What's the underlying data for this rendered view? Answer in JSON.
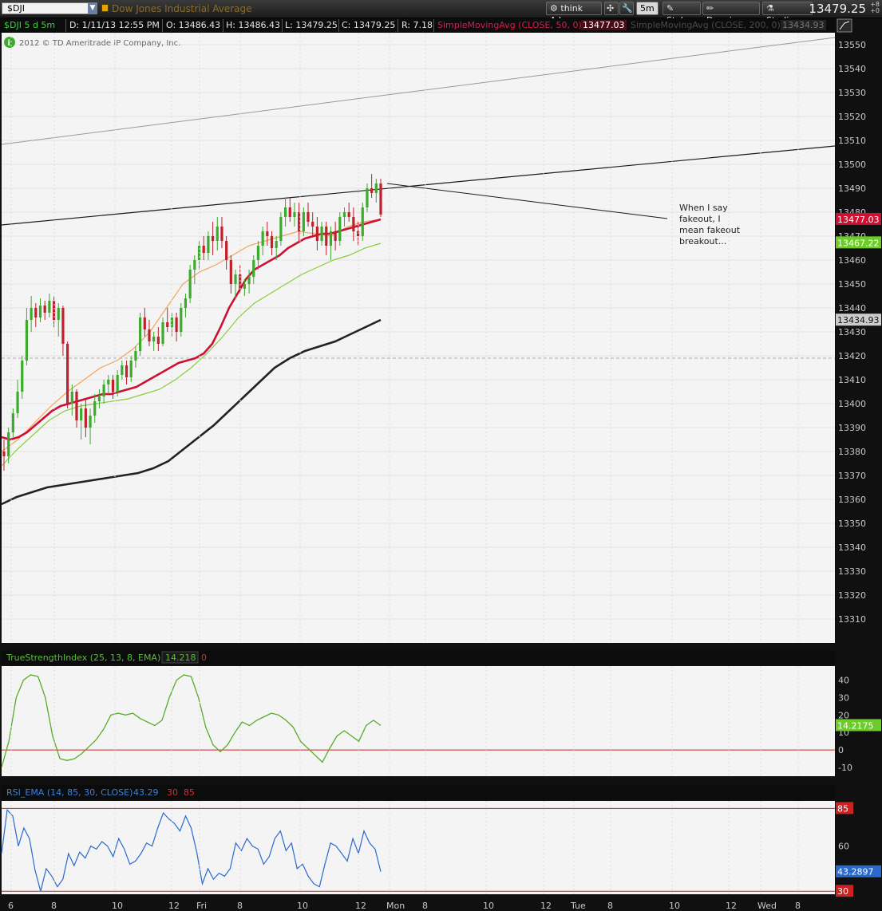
{
  "toolbar": {
    "symbol": "$DJI",
    "symbol_name": "Dow Jones Industrial Average",
    "think_ai": "think A.I.",
    "timeframe": "5m",
    "style": "Style",
    "drawings": "Drawings",
    "studies": "Studies",
    "last_price": "13479.25",
    "price_change_top": "+8",
    "price_change_bottom": "+0"
  },
  "status_bar": {
    "ticker": "$DJI 5 d 5m",
    "date": "D: 1/11/13 12:55 PM",
    "open": "O: 13486.43",
    "high": "H: 13486.43",
    "low": "L: 13479.25",
    "close": "C: 13479.25",
    "range": "R: 7.18",
    "sma50_label": "SimpleMovingAvg (CLOSE, 50, 0)",
    "sma50_value": "13477.03",
    "sma200_label": "SimpleMovingAvg (CLOSE, 200, 0)",
    "sma200_value": "13434.93",
    "copyright": "2012 © TD Ameritrade IP Company, Inc."
  },
  "annotation": {
    "line1": "When I say",
    "line2": "fakeout, I",
    "line3": "mean fakeout",
    "line4": "breakout..."
  },
  "colors": {
    "background": "#000000",
    "panel": "#f4f4f4",
    "up_candle": "#3caa2c",
    "down_candle": "#c0202c",
    "sma50": "#cc1133",
    "sma200": "#222222",
    "green_ma": "#8ccc3c",
    "orange_ma": "#f3a45a",
    "tsi_line": "#5aaa2a",
    "rsi_line": "#2a6acc",
    "ref_line": "#cc2222",
    "price_tag_red": "#cc1133",
    "price_tag_green": "#6ccc28",
    "price_tag_gray": "#cccccc"
  },
  "chart_data": [
    {
      "type": "candlestick",
      "ylim": [
        13300,
        13555
      ],
      "y_ticks": [
        13310,
        13320,
        13330,
        13340,
        13350,
        13360,
        13370,
        13380,
        13390,
        13400,
        13410,
        13420,
        13430,
        13440,
        13450,
        13460,
        13470,
        13480,
        13490,
        13500,
        13510,
        13520,
        13530,
        13540,
        13550
      ],
      "x_tick_labels": [
        "6",
        "8",
        "10",
        "12",
        "Fri",
        "8",
        "10",
        "12",
        "Mon",
        "8",
        "10",
        "12",
        "Tue",
        "8",
        "10",
        "12",
        "Wed",
        "8"
      ],
      "price_tags": [
        {
          "label": "13477.03",
          "value": 13477.03,
          "color": "#cc1133"
        },
        {
          "label": "13467.22",
          "value": 13467.22,
          "color": "#6ccc28"
        },
        {
          "label": "13434.93",
          "value": 13434.93,
          "color": "#cccccc"
        }
      ],
      "reference_level": 13419,
      "candles": [
        [
          13380,
          13385,
          13372,
          13378
        ],
        [
          13378,
          13390,
          13375,
          13388
        ],
        [
          13388,
          13398,
          13386,
          13396
        ],
        [
          13396,
          13410,
          13394,
          13405
        ],
        [
          13405,
          13420,
          13402,
          13418
        ],
        [
          13418,
          13440,
          13416,
          13435
        ],
        [
          13435,
          13445,
          13430,
          13440
        ],
        [
          13440,
          13442,
          13432,
          13436
        ],
        [
          13436,
          13444,
          13434,
          13441
        ],
        [
          13441,
          13443,
          13435,
          13438
        ],
        [
          13438,
          13446,
          13436,
          13443
        ],
        [
          13443,
          13445,
          13432,
          13435
        ],
        [
          13435,
          13442,
          13428,
          13440
        ],
        [
          13440,
          13441,
          13420,
          13425
        ],
        [
          13425,
          13426,
          13398,
          13400
        ],
        [
          13400,
          13408,
          13395,
          13405
        ],
        [
          13405,
          13406,
          13390,
          13393
        ],
        [
          13393,
          13400,
          13385,
          13398
        ],
        [
          13398,
          13402,
          13386,
          13390
        ],
        [
          13390,
          13398,
          13383,
          13395
        ],
        [
          13395,
          13404,
          13392,
          13401
        ],
        [
          13401,
          13406,
          13398,
          13403
        ],
        [
          13403,
          13410,
          13400,
          13408
        ],
        [
          13408,
          13412,
          13404,
          13410
        ],
        [
          13410,
          13412,
          13402,
          13405
        ],
        [
          13405,
          13414,
          13403,
          13412
        ],
        [
          13412,
          13418,
          13410,
          13416
        ],
        [
          13416,
          13418,
          13408,
          13411
        ],
        [
          13411,
          13420,
          13409,
          13418
        ],
        [
          13418,
          13424,
          13415,
          13422
        ],
        [
          13422,
          13438,
          13420,
          13436
        ],
        [
          13436,
          13440,
          13428,
          13431
        ],
        [
          13431,
          13435,
          13424,
          13426
        ],
        [
          13426,
          13430,
          13422,
          13428
        ],
        [
          13428,
          13432,
          13422,
          13425
        ],
        [
          13425,
          13436,
          13424,
          13434
        ],
        [
          13434,
          13440,
          13430,
          13432
        ],
        [
          13432,
          13438,
          13428,
          13436
        ],
        [
          13436,
          13438,
          13426,
          13430
        ],
        [
          13430,
          13442,
          13428,
          13440
        ],
        [
          13440,
          13446,
          13436,
          13444
        ],
        [
          13444,
          13458,
          13442,
          13456
        ],
        [
          13456,
          13462,
          13450,
          13460
        ],
        [
          13460,
          13468,
          13456,
          13466
        ],
        [
          13466,
          13470,
          13460,
          13463
        ],
        [
          13463,
          13472,
          13460,
          13470
        ],
        [
          13470,
          13476,
          13462,
          13468
        ],
        [
          13468,
          13478,
          13464,
          13474
        ],
        [
          13474,
          13478,
          13465,
          13468
        ],
        [
          13468,
          13470,
          13456,
          13460
        ],
        [
          13460,
          13462,
          13446,
          13450
        ],
        [
          13450,
          13456,
          13444,
          13454
        ],
        [
          13454,
          13458,
          13446,
          13448
        ],
        [
          13448,
          13452,
          13445,
          13450
        ],
        [
          13450,
          13456,
          13446,
          13453
        ],
        [
          13453,
          13462,
          13450,
          13460
        ],
        [
          13460,
          13468,
          13456,
          13466
        ],
        [
          13466,
          13474,
          13462,
          13472
        ],
        [
          13472,
          13476,
          13466,
          13470
        ],
        [
          13470,
          13472,
          13462,
          13465
        ],
        [
          13465,
          13470,
          13460,
          13468
        ],
        [
          13468,
          13480,
          13466,
          13478
        ],
        [
          13478,
          13486,
          13474,
          13482
        ],
        [
          13482,
          13486,
          13476,
          13478
        ],
        [
          13478,
          13484,
          13474,
          13480
        ],
        [
          13480,
          13484,
          13468,
          13472
        ],
        [
          13472,
          13482,
          13470,
          13480
        ],
        [
          13480,
          13484,
          13474,
          13476
        ],
        [
          13476,
          13480,
          13470,
          13474
        ],
        [
          13474,
          13478,
          13464,
          13468
        ],
        [
          13468,
          13476,
          13466,
          13474
        ],
        [
          13474,
          13476,
          13462,
          13466
        ],
        [
          13466,
          13474,
          13460,
          13472
        ],
        [
          13472,
          13476,
          13464,
          13468
        ],
        [
          13468,
          13480,
          13466,
          13478
        ],
        [
          13478,
          13482,
          13474,
          13480
        ],
        [
          13480,
          13484,
          13476,
          13478
        ],
        [
          13478,
          13482,
          13468,
          13472
        ],
        [
          13472,
          13476,
          13466,
          13470
        ],
        [
          13470,
          13484,
          13468,
          13482
        ],
        [
          13482,
          13492,
          13480,
          13490
        ],
        [
          13490,
          13496,
          13486,
          13488
        ],
        [
          13488,
          13494,
          13484,
          13492
        ],
        [
          13492,
          13494,
          13478,
          13479
        ]
      ],
      "sma50": [
        13386,
        13385,
        13386,
        13388,
        13391,
        13394,
        13397,
        13399,
        13400,
        13401,
        13402,
        13403,
        13404,
        13404,
        13405,
        13406,
        13407,
        13409,
        13411,
        13413,
        13415,
        13417,
        13418,
        13419,
        13421,
        13425,
        13432,
        13440,
        13446,
        13452,
        13456,
        13458,
        13460,
        13462,
        13465,
        13467,
        13469,
        13470,
        13471,
        13471,
        13472,
        13473,
        13474,
        13475,
        13476,
        13477
      ],
      "sma200": [
        13358,
        13361,
        13363,
        13365,
        13366,
        13367,
        13368,
        13369,
        13370,
        13371,
        13373,
        13376,
        13381,
        13386,
        13391,
        13397,
        13403,
        13409,
        13415,
        13419,
        13422,
        13424,
        13426,
        13429,
        13432,
        13435
      ],
      "green_ma": [
        13374,
        13381,
        13387,
        13393,
        13397,
        13399,
        13400,
        13401,
        13402,
        13404,
        13406,
        13410,
        13415,
        13421,
        13428,
        13436,
        13442,
        13446,
        13450,
        13454,
        13457,
        13460,
        13462,
        13465,
        13467
      ],
      "orange_ma": [
        13380,
        13385,
        13392,
        13399,
        13405,
        13410,
        13415,
        13418,
        13423,
        13430,
        13440,
        13450,
        13455,
        13458,
        13462,
        13466,
        13468,
        13470,
        13472,
        13471,
        13470,
        13474,
        13476,
        13477
      ]
    },
    {
      "type": "line",
      "title": "TrueStrengthIndex (25, 13, 8, EMA)",
      "values_label": "14.218",
      "signal_label": "0",
      "current_tag": "14.2175",
      "ylim": [
        -15,
        48
      ],
      "y_ticks": [
        -10,
        0,
        10,
        20,
        30,
        40
      ],
      "reference_level": 0,
      "values": [
        -10,
        5,
        30,
        40,
        43,
        42,
        30,
        8,
        -5,
        -6,
        -5,
        -2,
        2,
        6,
        12,
        20,
        21,
        20,
        21,
        18,
        16,
        14,
        17,
        30,
        40,
        43,
        42,
        30,
        13,
        3,
        -1,
        3,
        10,
        16,
        14,
        17,
        19,
        21,
        20,
        17,
        13,
        5,
        1,
        -3,
        -7,
        1,
        8,
        11,
        8,
        5,
        14,
        17,
        14
      ]
    },
    {
      "type": "line",
      "title": "RSI_EMA (14, 85, 30, CLOSE)",
      "values_label": "43.29",
      "oversold_label": "30",
      "overbought_label": "85",
      "current_tag": "43.2897",
      "overbought_tag": "85",
      "oversold_tag": "30",
      "ylim": [
        28,
        90
      ],
      "y_ticks": [
        60
      ],
      "reference_levels": [
        85,
        30
      ],
      "values": [
        55,
        84,
        80,
        60,
        72,
        65,
        44,
        30,
        45,
        40,
        33,
        38,
        55,
        47,
        56,
        52,
        60,
        58,
        63,
        60,
        53,
        65,
        58,
        48,
        50,
        55,
        62,
        60,
        72,
        82,
        78,
        75,
        70,
        80,
        72,
        56,
        35,
        45,
        38,
        42,
        40,
        45,
        62,
        57,
        65,
        60,
        58,
        48,
        53,
        65,
        70,
        57,
        62,
        45,
        48,
        40,
        35,
        33,
        48,
        62,
        60,
        55,
        50,
        65,
        55,
        70,
        62,
        58,
        43
      ]
    }
  ]
}
